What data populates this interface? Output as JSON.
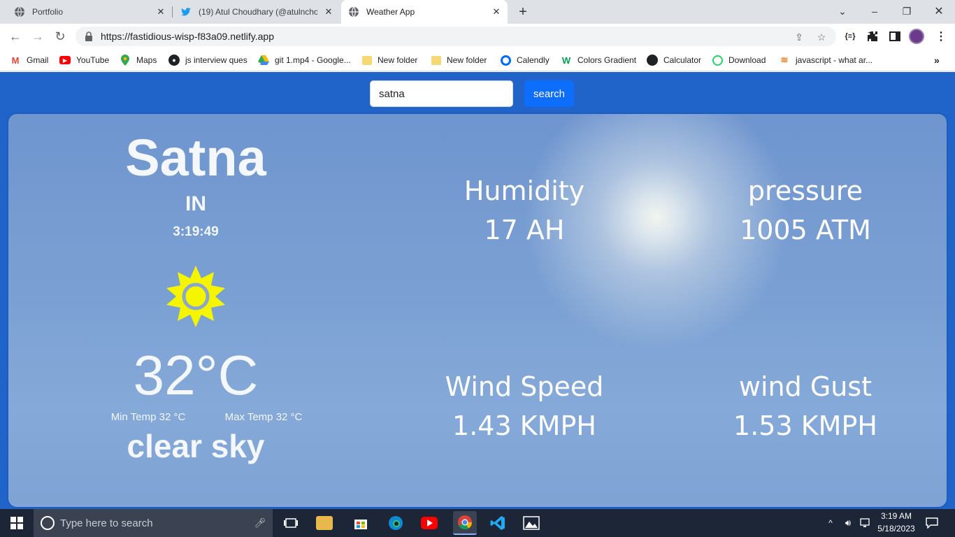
{
  "browser": {
    "tabs": [
      {
        "label": "Portfolio",
        "icon": "globe-icon"
      },
      {
        "label": "(19) Atul Choudhary (@atulnchou",
        "icon": "twitter-icon"
      },
      {
        "label": "Weather App",
        "icon": "globe-icon",
        "active": true
      }
    ],
    "url": "https://fastidious-wisp-f83a09.netlify.app",
    "bookmarks": [
      {
        "label": "Gmail",
        "icon": "gmail-icon"
      },
      {
        "label": "YouTube",
        "icon": "youtube-icon"
      },
      {
        "label": "Maps",
        "icon": "maps-icon"
      },
      {
        "label": "js interview ques",
        "icon": "github-icon"
      },
      {
        "label": "git 1.mp4 - Google...",
        "icon": "google-drive-icon"
      },
      {
        "label": "New folder",
        "icon": "folder-icon"
      },
      {
        "label": "New folder",
        "icon": "folder-icon"
      },
      {
        "label": "Calendly",
        "icon": "calendly-icon"
      },
      {
        "label": "Colors Gradient",
        "icon": "webgradients-icon"
      },
      {
        "label": "Calculator",
        "icon": "calculator-icon"
      },
      {
        "label": "Download",
        "icon": "whatsapp-icon"
      },
      {
        "label": "javascript - what ar...",
        "icon": "stackoverflow-icon"
      }
    ]
  },
  "weather": {
    "search_value": "satna",
    "search_label": "search",
    "city": "Satna",
    "country": "IN",
    "time": "3:19:49",
    "condition_icon": "sun-icon",
    "temperature": "32°C",
    "min_temp": "Min Temp 32 °C",
    "max_temp": "Max Temp 32 °C",
    "description": "clear sky",
    "humidity_label": "Humidity",
    "humidity_value": "17 AH",
    "pressure_label": "pressure",
    "pressure_value": "1005 ATM",
    "wind_speed_label": "Wind Speed",
    "wind_speed_value": "1.43 KMPH",
    "wind_gust_label": "wind Gust",
    "wind_gust_value": "1.53 KMPH"
  },
  "taskbar": {
    "search_placeholder": "Type here to search",
    "time": "3:19 AM",
    "date": "5/18/2023"
  },
  "colors": {
    "page_bg": "#2063c9",
    "search_button": "#0d6efd",
    "sun": "#f5f500"
  }
}
